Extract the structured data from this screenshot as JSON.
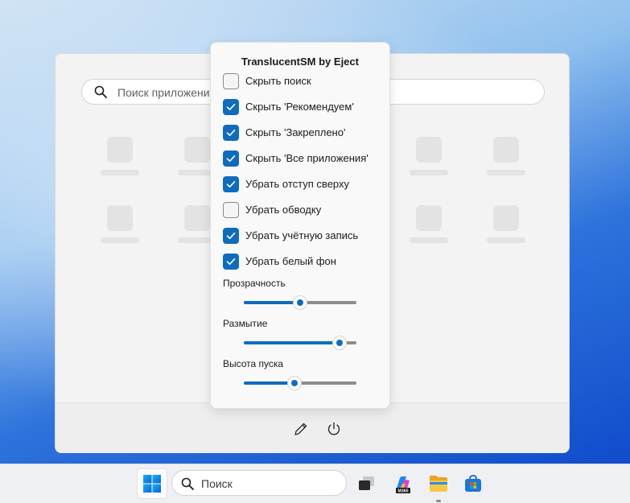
{
  "start_menu": {
    "search_placeholder": "Поиск приложени",
    "footer_icons": [
      "edit-pencil-icon",
      "power-icon"
    ]
  },
  "panel": {
    "title": "TranslucentSM by Eject",
    "options": [
      {
        "label": "Скрыть поиск",
        "checked": false
      },
      {
        "label": "Скрыть 'Рекомендуем'",
        "checked": true
      },
      {
        "label": "Скрыть 'Закреплено'",
        "checked": true
      },
      {
        "label": "Скрыть 'Все приложения'",
        "checked": true
      },
      {
        "label": "Убрать отступ сверху",
        "checked": true
      },
      {
        "label": "Убрать обводку",
        "checked": false
      },
      {
        "label": "Убрать учётную запись",
        "checked": true
      },
      {
        "label": "Убрать белый фон",
        "checked": true
      }
    ],
    "sliders": [
      {
        "label": "Прозрачность",
        "value": 0.5
      },
      {
        "label": "Размытие",
        "value": 0.85
      },
      {
        "label": "Высота пуска",
        "value": 0.45
      }
    ]
  },
  "taskbar": {
    "search_placeholder": "Поиск",
    "apps": [
      "start-windows-icon",
      "task-view-icon",
      "copilot-m365-icon",
      "file-explorer-icon",
      "microsoft-store-icon"
    ],
    "colors": {
      "accent": "#0f6cbd"
    }
  }
}
